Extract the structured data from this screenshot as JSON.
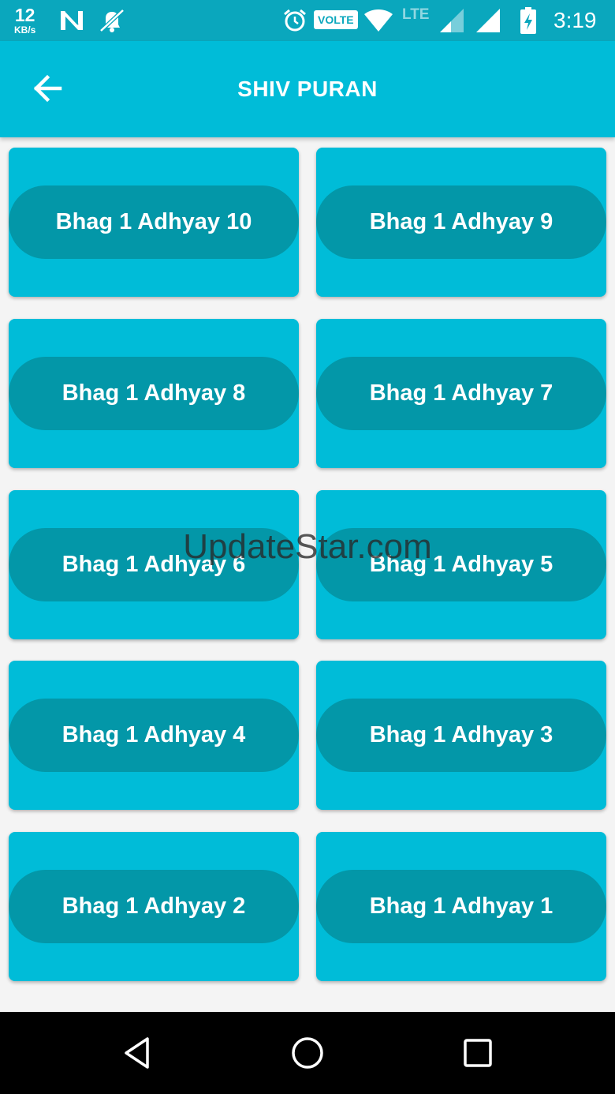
{
  "status_bar": {
    "net_speed_value": "12",
    "net_speed_unit": "KB/s",
    "volte_label": "VOLTE",
    "lte_label": "LTE",
    "time": "3:19",
    "icons": [
      "n-icon",
      "no-notifications-icon",
      "alarm-icon",
      "wifi-icon",
      "signal-icon",
      "battery-charging-icon"
    ]
  },
  "app_bar": {
    "title": "SHIV PURAN",
    "back_icon": "arrow-left-icon"
  },
  "chapters": [
    {
      "label": "Bhag 1 Adhyay 10"
    },
    {
      "label": "Bhag 1 Adhyay 9"
    },
    {
      "label": "Bhag 1 Adhyay 8"
    },
    {
      "label": "Bhag 1 Adhyay 7"
    },
    {
      "label": "Bhag 1 Adhyay 6"
    },
    {
      "label": "Bhag 1 Adhyay 5"
    },
    {
      "label": "Bhag 1 Adhyay 4"
    },
    {
      "label": "Bhag 1 Adhyay 3"
    },
    {
      "label": "Bhag 1 Adhyay 2"
    },
    {
      "label": "Bhag 1 Adhyay 1"
    }
  ],
  "watermark": "UpdateStar.com",
  "nav_bar": {
    "icons": [
      "back-triangle-icon",
      "home-circle-icon",
      "recents-square-icon"
    ]
  },
  "colors": {
    "status_bar": "#0aa7bd",
    "primary": "#00bcd8",
    "pill": "#0397a8",
    "background": "#f4f4f4"
  }
}
